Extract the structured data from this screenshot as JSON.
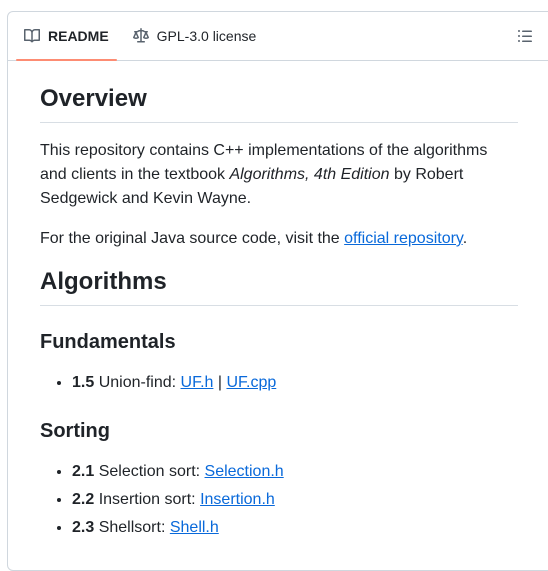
{
  "tabs": {
    "readme": "README",
    "license": "GPL-3.0 license"
  },
  "overview": {
    "heading": "Overview",
    "p1_a": "This repository contains C++ implementations of the algorithms and clients in the textbook ",
    "p1_book": "Algorithms, 4th Edition",
    "p1_b": " by Robert Sedgewick and Kevin Wayne.",
    "p2_a": "For the original Java source code, visit the ",
    "p2_link": "official repository",
    "p2_b": "."
  },
  "algorithms": {
    "heading": "Algorithms",
    "fundamentals": {
      "heading": "Fundamentals",
      "items": [
        {
          "num": "1.5",
          "text": " Union-find: ",
          "link1": "UF.h",
          "sep": " | ",
          "link2": "UF.cpp"
        }
      ]
    },
    "sorting": {
      "heading": "Sorting",
      "items": [
        {
          "num": "2.1",
          "text": " Selection sort: ",
          "link1": "Selection.h"
        },
        {
          "num": "2.2",
          "text": " Insertion sort: ",
          "link1": "Insertion.h"
        },
        {
          "num": "2.3",
          "text": " Shellsort: ",
          "link1": "Shell.h"
        }
      ]
    }
  }
}
